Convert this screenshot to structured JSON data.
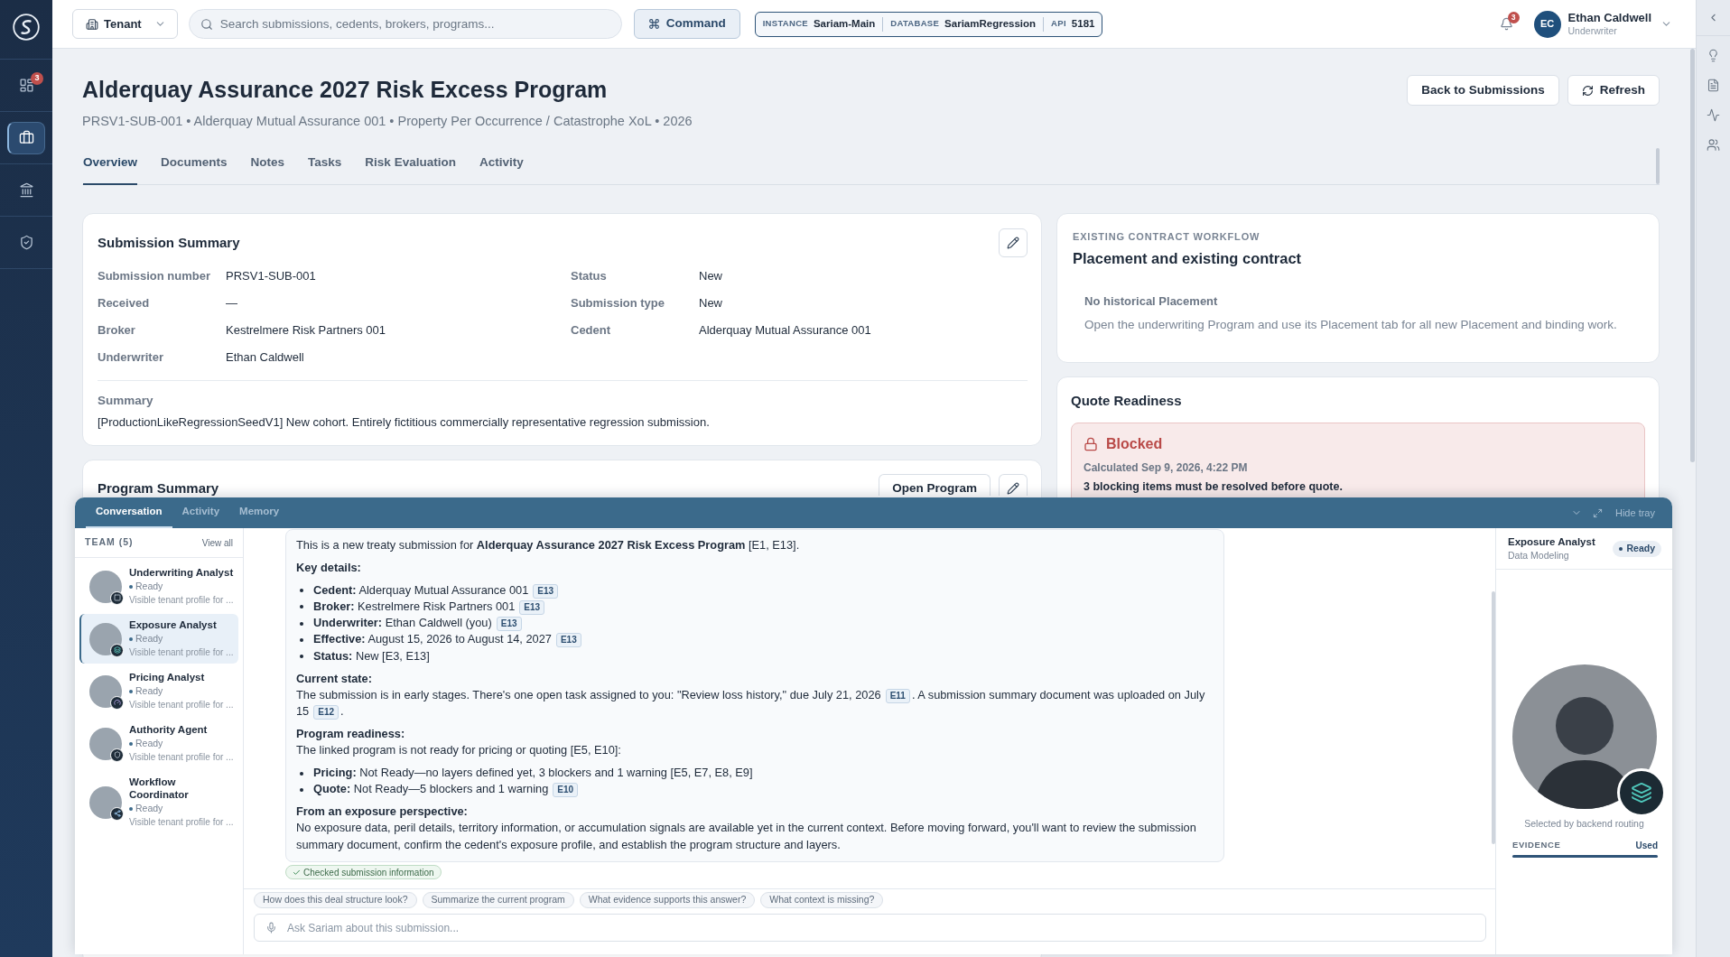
{
  "sidebar": {
    "items": [
      {
        "badge": "3",
        "selected": false
      },
      {
        "selected": true
      },
      {
        "selected": false
      },
      {
        "selected": false
      }
    ]
  },
  "top_bar": {
    "tenant": "Tenant",
    "search": {
      "placeholder": "Search submissions, cedents, brokers, programs..."
    },
    "command": "Command",
    "environment": [
      {
        "label": "INSTANCE",
        "value": "Sariam-Main"
      },
      {
        "label": "DATABASE",
        "value": "SariamRegression"
      },
      {
        "label": "API",
        "value": "5181"
      }
    ],
    "notifications": {
      "badge": "3"
    },
    "user": {
      "initials": "EC",
      "name": "Ethan Caldwell",
      "role": "Underwriter"
    }
  },
  "page": {
    "title": "Alderquay Assurance 2027 Risk Excess Program",
    "subtitle": "PRSV1-SUB-001 • Alderquay Mutual Assurance 001 • Property Per Occurrence / Catastrophe XoL • 2026",
    "actions": [
      {
        "label": "Back to Submissions",
        "kind": "text"
      },
      {
        "label": "Refresh",
        "kind": "refresh"
      }
    ],
    "tabs": [
      {
        "label": "Overview",
        "selected": true
      },
      {
        "label": "Documents",
        "selected": false
      },
      {
        "label": "Notes",
        "selected": false
      },
      {
        "label": "Tasks",
        "selected": false
      },
      {
        "label": "Risk Evaluation",
        "selected": false
      },
      {
        "label": "Activity",
        "selected": false
      }
    ]
  },
  "submission_summary": {
    "title": "Submission Summary",
    "fields": [
      {
        "label": "Submission number",
        "value": "PRSV1-SUB-001"
      },
      {
        "label": "Status",
        "value": "New"
      },
      {
        "label": "Received",
        "value": "—"
      },
      {
        "label": "Submission type",
        "value": "New"
      },
      {
        "label": "Broker",
        "value": "Kestrelmere Risk Partners 001"
      },
      {
        "label": "Cedent",
        "value": "Alderquay Mutual Assurance 001"
      },
      {
        "label": "Underwriter",
        "value": "Ethan Caldwell"
      }
    ],
    "summary_label": "Summary",
    "summary": "[ProductionLikeRegressionSeedV1] New cohort. Entirely fictitious commercially representative regression submission."
  },
  "program_summary": {
    "title": "Program Summary",
    "action": "Open Program"
  },
  "contract_workflow": {
    "overline": "EXISTING CONTRACT WORKFLOW",
    "title": "Placement and existing contract",
    "empty_title": "No historical Placement",
    "empty_text": "Open the underwriting Program and use its Placement tab for all new Placement and binding work."
  },
  "quote_readiness": {
    "title": "Quote Readiness",
    "status": "Blocked",
    "calculated": "Calculated Sep 9, 2026, 4:22 PM",
    "message": "3 blocking items must be resolved before quote."
  },
  "tray": {
    "tabs": [
      {
        "label": "Conversation",
        "selected": true
      },
      {
        "label": "Activity",
        "selected": false
      },
      {
        "label": "Memory",
        "selected": false
      }
    ],
    "hide_label": "Hide tray",
    "team": {
      "title": "TEAM (5)",
      "view_all": "View all",
      "members": [
        {
          "name": "Underwriting Analyst",
          "status": "Ready",
          "description": "Visible tenant profile for ...",
          "selected": false
        },
        {
          "name": "Exposure Analyst",
          "status": "Ready",
          "description": "Visible tenant profile for ...",
          "selected": true
        },
        {
          "name": "Pricing Analyst",
          "status": "Ready",
          "description": "Visible tenant profile for ...",
          "selected": false
        },
        {
          "name": "Authority Agent",
          "status": "Ready",
          "description": "Visible tenant profile for ...",
          "selected": false
        },
        {
          "name": "Workflow Coordinator",
          "status": "Ready",
          "description": "Visible tenant profile for ...",
          "selected": false
        }
      ]
    },
    "message": {
      "blocks": [
        {
          "kind": "paragraph",
          "segments": [
            {
              "kind": "text",
              "text": "This is a new treaty submission for **Alderquay Assurance 2027 Risk Excess Program** [E1, E13]."
            }
          ]
        },
        {
          "kind": "heading",
          "text": "Key details:"
        },
        {
          "kind": "list",
          "items": [
            {
              "segments": [
                {
                  "kind": "text",
                  "text": "**Cedent:** Alderquay Mutual Assurance 001"
                },
                {
                  "kind": "citation",
                  "text": "E13"
                }
              ]
            },
            {
              "segments": [
                {
                  "kind": "text",
                  "text": "**Broker:** Kestrelmere Risk Partners 001"
                },
                {
                  "kind": "citation",
                  "text": "E13"
                }
              ]
            },
            {
              "segments": [
                {
                  "kind": "text",
                  "text": "**Underwriter:** Ethan Caldwell (you)"
                },
                {
                  "kind": "citation",
                  "text": "E13"
                }
              ]
            },
            {
              "segments": [
                {
                  "kind": "text",
                  "text": "**Effective:** August 15, 2026 to August 14, 2027"
                },
                {
                  "kind": "citation",
                  "text": "E13"
                }
              ]
            },
            {
              "segments": [
                {
                  "kind": "text",
                  "text": "**Status:** New [E3, E13]"
                }
              ]
            }
          ]
        },
        {
          "kind": "heading",
          "text": "Current state:"
        },
        {
          "kind": "paragraph",
          "segments": [
            {
              "kind": "text",
              "text": "The submission is in early stages. There's one open task assigned to you: \"Review loss history,\" due July 21, 2026"
            },
            {
              "kind": "citation",
              "text": "E11"
            },
            {
              "kind": "text",
              "text": ". A submission summary document was uploaded on July"
            },
            {
              "kind": "text",
              "text": "15"
            },
            {
              "kind": "citation",
              "text": "E12"
            },
            {
              "kind": "text",
              "text": "."
            }
          ]
        },
        {
          "kind": "heading",
          "text": "Program readiness:"
        },
        {
          "kind": "paragraph",
          "segments": [
            {
              "kind": "text",
              "text": "The linked program is not ready for pricing or quoting [E5, E10]:"
            }
          ]
        },
        {
          "kind": "list",
          "items": [
            {
              "segments": [
                {
                  "kind": "text",
                  "text": "**Pricing:** Not Ready—no layers defined yet, 3 blockers and 1 warning [E5, E7, E8, E9]"
                }
              ]
            },
            {
              "segments": [
                {
                  "kind": "text",
                  "text": "**Quote:** Not Ready—5 blockers and 1 warning"
                },
                {
                  "kind": "citation",
                  "text": "E10"
                }
              ]
            }
          ]
        },
        {
          "kind": "heading",
          "text": "From an exposure perspective:"
        },
        {
          "kind": "paragraph",
          "segments": [
            {
              "kind": "text",
              "text": "No exposure data, peril details, territory information, or accumulation signals are available yet in the current context. Before moving forward, you'll want to review the submission summary document, confirm the cedent's exposure profile, and establish the program structure and layers."
            }
          ]
        }
      ]
    },
    "activity_chip": "Checked submission information",
    "suggestions": [
      "How does this deal structure look?",
      "Summarize the current program",
      "What evidence supports this answer?",
      "What context is missing?"
    ],
    "composer": {
      "placeholder": "Ask Sariam about this submission..."
    },
    "agent_panel": {
      "name": "Exposure Analyst",
      "subtitle": "Data Modeling",
      "status": "Ready",
      "caption": "Selected by backend routing",
      "evidence": {
        "label": "EVIDENCE",
        "value": "Used",
        "level": 1
      }
    }
  }
}
